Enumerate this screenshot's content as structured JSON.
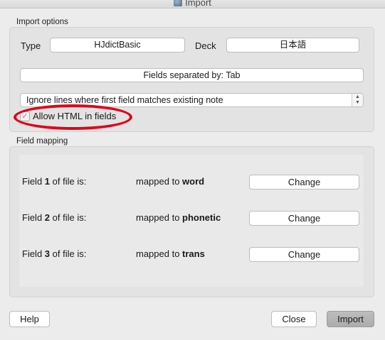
{
  "window": {
    "title": "Import",
    "icon": "anki-app-icon"
  },
  "import_options": {
    "group_title": "Import options",
    "type_label": "Type",
    "type_value": "HJdictBasic",
    "deck_label": "Deck",
    "deck_value": "日本語",
    "separator": "Fields separated by: Tab",
    "duplicate_handling": "Ignore lines where first field matches existing note",
    "allow_html_label": "Allow HTML in fields",
    "allow_html_checked": true
  },
  "field_mapping": {
    "group_title": "Field mapping",
    "rows": [
      {
        "prefix": "Field ",
        "num": "1",
        "suffix": " of file is:",
        "mapped_prefix": "mapped to ",
        "target": "word",
        "button": "Change"
      },
      {
        "prefix": "Field ",
        "num": "2",
        "suffix": " of file is:",
        "mapped_prefix": "mapped to ",
        "target": "phonetic",
        "button": "Change"
      },
      {
        "prefix": "Field ",
        "num": "3",
        "suffix": " of file is:",
        "mapped_prefix": "mapped to ",
        "target": "trans",
        "button": "Change"
      }
    ]
  },
  "buttons": {
    "help": "Help",
    "close": "Close",
    "import": "Import"
  },
  "colors": {
    "highlight_ring": "#e0001a",
    "default_button": "#b4b4b4"
  }
}
